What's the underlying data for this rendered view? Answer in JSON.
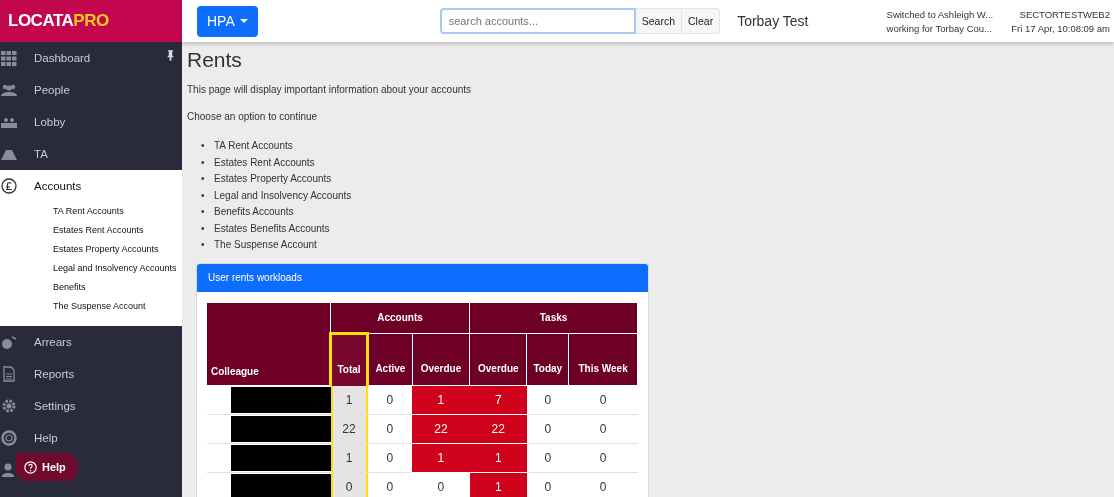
{
  "logo": {
    "part_1": "LOCATA",
    "part_2": "PRO"
  },
  "topbar": {
    "org_button": "HPA",
    "search": {
      "placeholder": "search accounts..."
    },
    "search_button": "Search",
    "clear_button": "Clear",
    "site": "Torbay Test",
    "user_line_1": "Switched to Ashleigh W...",
    "user_line_2": "working for Torbay Cou...",
    "server": "SECTORTESTWEB2",
    "datetime": "Fri 17 Apr, 10:08:09 am"
  },
  "sidebar": {
    "items": [
      {
        "label": "Dashboard",
        "expanded": false,
        "pinned": true
      },
      {
        "label": "People",
        "expanded": false,
        "pinned": false
      },
      {
        "label": "Lobby",
        "expanded": false,
        "pinned": false
      },
      {
        "label": "TA",
        "expanded": false,
        "pinned": false
      },
      {
        "label": "Accounts",
        "expanded": true,
        "pinned": false,
        "children": [
          {
            "label": "TA Rent Accounts"
          },
          {
            "label": "Estates Rent Accounts"
          },
          {
            "label": "Estates Property Accounts"
          },
          {
            "label": "Legal and Insolvency Accounts"
          },
          {
            "label": "Benefits"
          },
          {
            "label": "The Suspense Account"
          }
        ]
      },
      {
        "label": "Arrears",
        "expanded": false,
        "pinned": false
      },
      {
        "label": "Reports",
        "expanded": false,
        "pinned": false
      },
      {
        "label": "Settings",
        "expanded": false,
        "pinned": false
      },
      {
        "label": "Help",
        "expanded": false,
        "pinned": false
      }
    ]
  },
  "help_button": "Help",
  "page": {
    "title": "Rents",
    "intro": "This page will display important information about your accounts",
    "prompt": "Choose an option to continue",
    "links": [
      {
        "bullet": "•",
        "label": "TA Rent Accounts"
      },
      {
        "bullet": "•",
        "label": "Estates Rent Accounts"
      },
      {
        "bullet": "•",
        "label": "Estates Property Accounts"
      },
      {
        "bullet": "•",
        "label": "Legal and Insolvency Accounts"
      },
      {
        "bullet": "•",
        "label": "Benefits Accounts"
      },
      {
        "bullet": "•",
        "label": "Estates Benefits Accounts"
      },
      {
        "bullet": "•",
        "label": "The Suspense Account"
      }
    ]
  },
  "workloads": {
    "title": "User rents workloads",
    "first_column": "Colleague",
    "groups": [
      {
        "label": "Accounts"
      },
      {
        "label": "Tasks"
      }
    ],
    "columns": [
      {
        "label": "Total",
        "highlighted": true
      },
      {
        "label": "Active",
        "highlighted": false
      },
      {
        "label": "Overdue",
        "highlighted": false
      },
      {
        "label": "Overdue",
        "highlighted": false
      },
      {
        "label": "Today",
        "highlighted": false
      },
      {
        "label": "This Week",
        "highlighted": false
      }
    ],
    "rows": [
      {
        "cells": [
          {
            "value": "1",
            "alert": false
          },
          {
            "value": "0",
            "alert": false
          },
          {
            "value": "1",
            "alert": true
          },
          {
            "value": "7",
            "alert": true
          },
          {
            "value": "0",
            "alert": false
          },
          {
            "value": "0",
            "alert": false
          }
        ]
      },
      {
        "cells": [
          {
            "value": "22",
            "alert": false
          },
          {
            "value": "0",
            "alert": false
          },
          {
            "value": "22",
            "alert": true
          },
          {
            "value": "22",
            "alert": true
          },
          {
            "value": "0",
            "alert": false
          },
          {
            "value": "0",
            "alert": false
          }
        ]
      },
      {
        "cells": [
          {
            "value": "1",
            "alert": false
          },
          {
            "value": "0",
            "alert": false
          },
          {
            "value": "1",
            "alert": true
          },
          {
            "value": "1",
            "alert": true
          },
          {
            "value": "0",
            "alert": false
          },
          {
            "value": "0",
            "alert": false
          }
        ]
      },
      {
        "cells": [
          {
            "value": "0",
            "alert": false
          },
          {
            "value": "0",
            "alert": false
          },
          {
            "value": "0",
            "alert": false
          },
          {
            "value": "1",
            "alert": true
          },
          {
            "value": "0",
            "alert": false
          },
          {
            "value": "0",
            "alert": false
          }
        ]
      }
    ]
  }
}
